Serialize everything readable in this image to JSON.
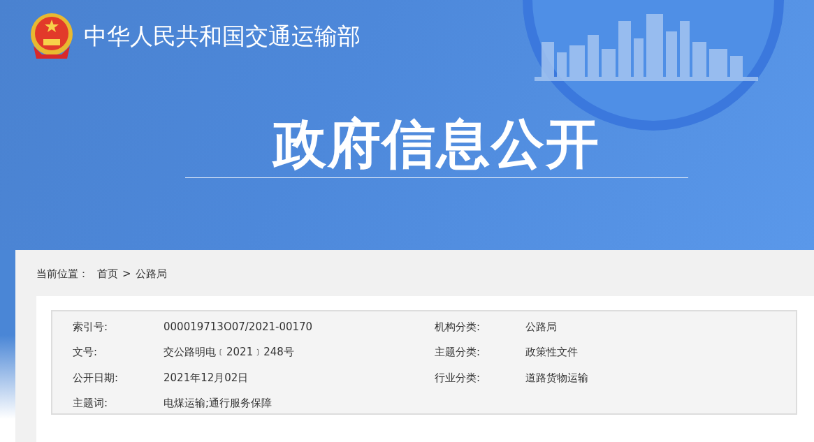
{
  "header": {
    "site_name": "中华人民共和国交通运输部",
    "section_title": "政府信息公开"
  },
  "breadcrumb": {
    "label": "当前位置：",
    "items": [
      {
        "text": "首页"
      },
      {
        "text": "公路局"
      }
    ],
    "separator": ">"
  },
  "metadata": [
    {
      "label": "索引号:",
      "value": "000019713O07/2021-00170"
    },
    {
      "label": "机构分类:",
      "value": "公路局"
    },
    {
      "label": "文号:",
      "value": "交公路明电﹝2021﹞248号"
    },
    {
      "label": "主题分类:",
      "value": "政策性文件"
    },
    {
      "label": "公开日期:",
      "value": "2021年12月02日"
    },
    {
      "label": "行业分类:",
      "value": "道路货物运输"
    },
    {
      "label": "主题词:",
      "value": "电煤运输;通行服务保障"
    }
  ]
}
